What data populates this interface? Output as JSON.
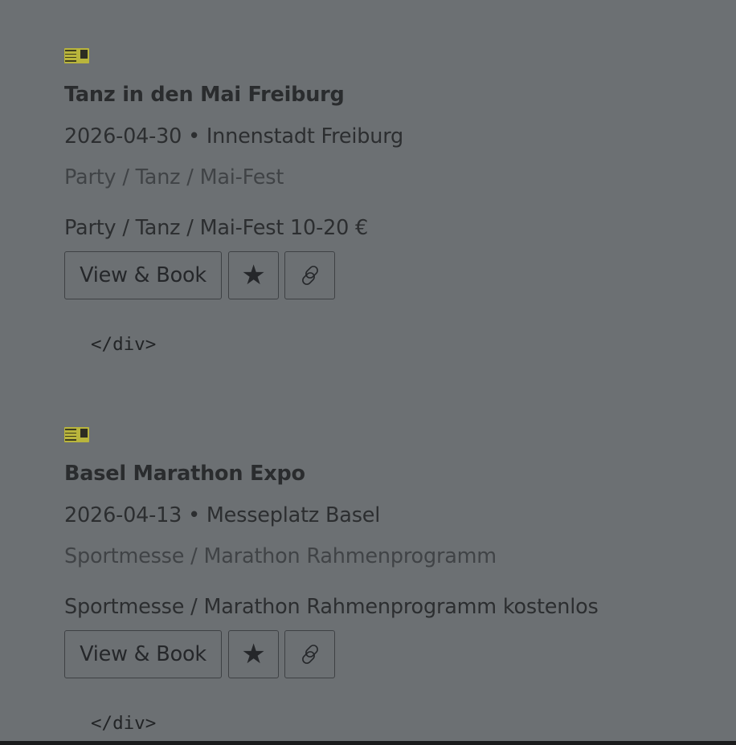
{
  "events": [
    {
      "title": "Tanz in den Mai Freiburg",
      "meta": "2026-04-30 • Innenstadt Freiburg",
      "category": "Party / Tanz / Mai-Fest",
      "description": "Party / Tanz / Mai-Fest 10-20 €",
      "book_label": "View & Book",
      "star_label": "★",
      "link_icon": "link-icon",
      "thumbnail_icon": "event-thumbnail-image",
      "code_snippet": "</div>"
    },
    {
      "title": "Basel Marathon Expo",
      "meta": "2026-04-13 • Messeplatz Basel",
      "category": "Sportmesse / Marathon Rahmenprogramm",
      "description": "Sportmesse / Marathon Rahmenprogramm kostenlos",
      "book_label": "View & Book",
      "star_label": "★",
      "link_icon": "link-icon",
      "thumbnail_icon": "event-thumbnail-image",
      "code_snippet": "</div>"
    }
  ],
  "colors": {
    "overlay_background": "#6c7073",
    "text_primary": "#2a2c2e",
    "text_muted": "#404346",
    "thumbnail_yellow": "#b9b53c"
  }
}
